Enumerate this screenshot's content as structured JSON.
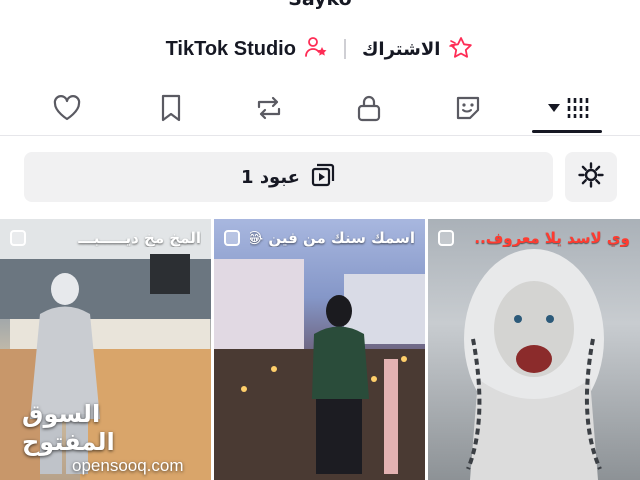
{
  "profile": {
    "username": "Sayko"
  },
  "links": {
    "studio_label": "TikTok Studio",
    "subscribe_label": "الاشتراك"
  },
  "tabs": [
    {
      "name": "videos",
      "icon": "grid-icon"
    },
    {
      "name": "stickers",
      "icon": "sticker-icon"
    },
    {
      "name": "private",
      "icon": "lock-icon"
    },
    {
      "name": "reposts",
      "icon": "repost-icon"
    },
    {
      "name": "favorites",
      "icon": "bookmark-icon"
    },
    {
      "name": "liked",
      "icon": "heart-icon"
    }
  ],
  "playlist": {
    "label": "عبود 1"
  },
  "videos": [
    {
      "caption": "المخ مخ ديـــــبـــ",
      "icon": "select-icon"
    },
    {
      "caption": "اسمك سنك من فين 😂",
      "icon": "select-icon"
    },
    {
      "caption": "وي لاسد يلا معروف..",
      "icon": "select-icon"
    }
  ],
  "watermark": {
    "arabic": "السوق المفتوح",
    "latin": "opensooq.com"
  },
  "colors": {
    "text": "#161823",
    "accent_pink": "#fe2c55",
    "button_bg": "#f1f1f2"
  }
}
